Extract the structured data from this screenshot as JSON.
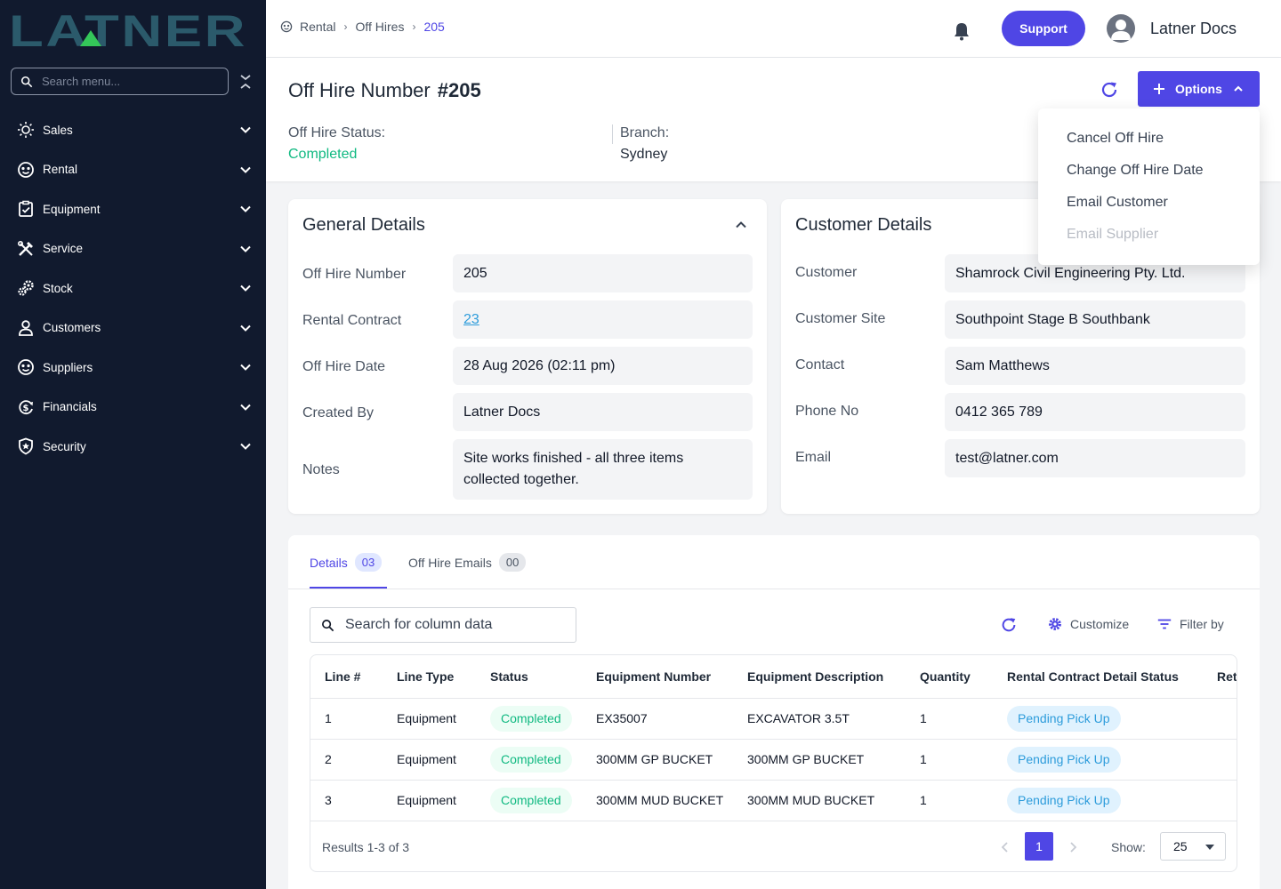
{
  "brand": {
    "logo_text": "LATNER",
    "logo_color": "#2b5a6b",
    "accent_color": "#4f46e5",
    "status_green": "#10b981",
    "link_blue": "#2d9cdb"
  },
  "sidebar": {
    "search_placeholder": "Search menu...",
    "items": [
      {
        "label": "Sales",
        "icon": "sun-icon"
      },
      {
        "label": "Rental",
        "icon": "face-icon"
      },
      {
        "label": "Equipment",
        "icon": "clipboard-check-icon"
      },
      {
        "label": "Service",
        "icon": "tools-icon"
      },
      {
        "label": "Stock",
        "icon": "gears-icon"
      },
      {
        "label": "Customers",
        "icon": "user-icon"
      },
      {
        "label": "Suppliers",
        "icon": "face-icon"
      },
      {
        "label": "Financials",
        "icon": "dollar-refresh-icon"
      },
      {
        "label": "Security",
        "icon": "shield-star-icon"
      }
    ]
  },
  "topbar": {
    "breadcrumbs": [
      "Rental",
      "Off Hires",
      "205"
    ],
    "support_label": "Support",
    "user_name": "Latner Docs"
  },
  "header": {
    "title_label": "Off Hire Number",
    "title_number": "#205",
    "status_label": "Off Hire Status:",
    "status_value": "Completed",
    "branch_label": "Branch:",
    "branch_value": "Sydney",
    "options_label": "Options"
  },
  "options_menu": {
    "items": [
      {
        "label": "Cancel Off Hire",
        "enabled": true
      },
      {
        "label": "Change Off Hire Date",
        "enabled": true
      },
      {
        "label": "Email Customer",
        "enabled": true
      },
      {
        "label": "Email Supplier",
        "enabled": false
      }
    ]
  },
  "general": {
    "title": "General Details",
    "fields": [
      {
        "label": "Off Hire Number",
        "value": "205"
      },
      {
        "label": "Rental Contract",
        "value": "23"
      },
      {
        "label": "Off Hire Date",
        "value": "28 Aug 2026 (02:11 pm)"
      },
      {
        "label": "Created By",
        "value": "Latner Docs"
      },
      {
        "label": "Notes",
        "value": "Site works finished - all three items collected together."
      }
    ]
  },
  "customer": {
    "title": "Customer Details",
    "fields": [
      {
        "label": "Customer",
        "value": "Shamrock Civil Engineering Pty. Ltd."
      },
      {
        "label": "Customer Site",
        "value": "Southpoint Stage B Southbank"
      },
      {
        "label": "Contact",
        "value": "Sam Matthews"
      },
      {
        "label": "Phone No",
        "value": "0412 365 789"
      },
      {
        "label": "Email",
        "value": "test@latner.com"
      }
    ]
  },
  "tabs": [
    {
      "label": "Details",
      "count": "03",
      "active": true
    },
    {
      "label": "Off Hire Emails",
      "count": "00",
      "active": false
    }
  ],
  "table": {
    "search_placeholder": "Search for column data",
    "customize_label": "Customize",
    "filter_label": "Filter by",
    "columns": [
      "Line #",
      "Line Type",
      "Status",
      "Equipment Number",
      "Equipment Description",
      "Quantity",
      "Rental Contract Detail Status",
      "Ret"
    ],
    "rows": [
      {
        "line": "1",
        "type": "Equipment",
        "status": "Completed",
        "equipment_number": "EX35007",
        "description": "EXCAVATOR 3.5T",
        "quantity": "1",
        "detail_status": "Pending Pick Up"
      },
      {
        "line": "2",
        "type": "Equipment",
        "status": "Completed",
        "equipment_number": "300MM GP BUCKET",
        "description": "300MM GP BUCKET",
        "quantity": "1",
        "detail_status": "Pending Pick Up"
      },
      {
        "line": "3",
        "type": "Equipment",
        "status": "Completed",
        "equipment_number": "300MM MUD BUCKET",
        "description": "300MM MUD BUCKET",
        "quantity": "1",
        "detail_status": "Pending Pick Up"
      }
    ],
    "results_text": "Results 1-3 of 3",
    "current_page": "1",
    "show_label": "Show:",
    "page_size": "25"
  }
}
